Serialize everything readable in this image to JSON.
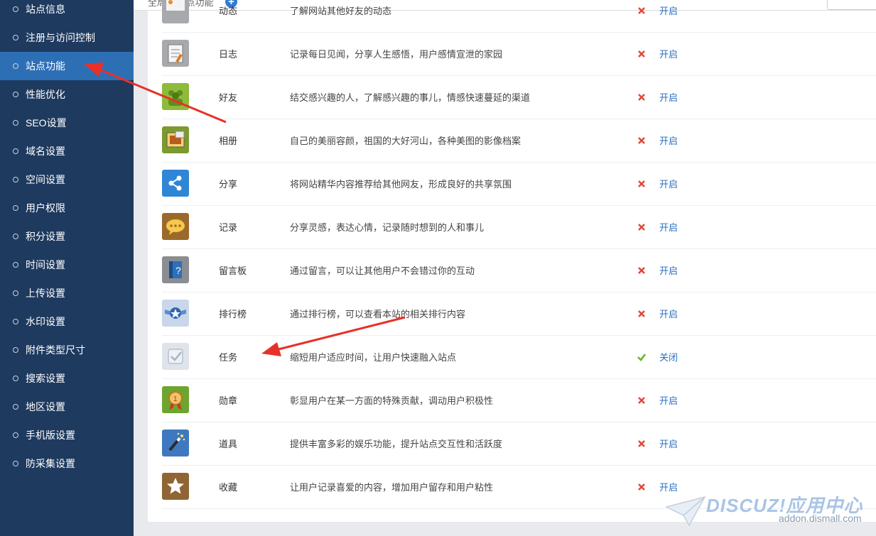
{
  "sidebar": {
    "items": [
      {
        "label": "站点信息"
      },
      {
        "label": "注册与访问控制"
      },
      {
        "label": "站点功能",
        "active": true
      },
      {
        "label": "性能优化"
      },
      {
        "label": "SEO设置"
      },
      {
        "label": "域名设置"
      },
      {
        "label": "空间设置"
      },
      {
        "label": "用户权限"
      },
      {
        "label": "积分设置"
      },
      {
        "label": "时间设置"
      },
      {
        "label": "上传设置"
      },
      {
        "label": "水印设置"
      },
      {
        "label": "附件类型尺寸"
      },
      {
        "label": "搜索设置"
      },
      {
        "label": "地区设置"
      },
      {
        "label": "手机版设置"
      },
      {
        "label": "防采集设置"
      }
    ]
  },
  "header": {
    "breadcrumb": "全局 » 站点功能"
  },
  "features": [
    {
      "name": "动态",
      "desc": "了解网站其他好友的动态",
      "enabled": false,
      "action": "开启",
      "icon": "feed-icon"
    },
    {
      "name": "日志",
      "desc": "记录每日见闻，分享人生感悟，用户感情宣泄的家园",
      "enabled": false,
      "action": "开启",
      "icon": "blog-icon"
    },
    {
      "name": "好友",
      "desc": "结交感兴趣的人，了解感兴趣的事儿，情感快速蔓延的渠道",
      "enabled": false,
      "action": "开启",
      "icon": "friends-icon"
    },
    {
      "name": "相册",
      "desc": "自己的美丽容颜，祖国的大好河山，各种美图的影像档案",
      "enabled": false,
      "action": "开启",
      "icon": "album-icon"
    },
    {
      "name": "分享",
      "desc": "将网站精华内容推荐给其他网友，形成良好的共享氛围",
      "enabled": false,
      "action": "开启",
      "icon": "share-icon"
    },
    {
      "name": "记录",
      "desc": "分享灵感，表达心情，记录随时想到的人和事儿",
      "enabled": false,
      "action": "开启",
      "icon": "doing-icon"
    },
    {
      "name": "留言板",
      "desc": "通过留言，可以让其他用户不会错过你的互动",
      "enabled": false,
      "action": "开启",
      "icon": "wall-icon"
    },
    {
      "name": "排行榜",
      "desc": "通过排行榜，可以查看本站的相关排行内容",
      "enabled": false,
      "action": "开启",
      "icon": "ranklist-icon"
    },
    {
      "name": "任务",
      "desc": "缩短用户适应时间，让用户快速融入站点",
      "enabled": true,
      "action": "关闭",
      "icon": "task-icon"
    },
    {
      "name": "勋章",
      "desc": "彰显用户在某一方面的特殊贡献，调动用户积极性",
      "enabled": false,
      "action": "开启",
      "icon": "medal-icon"
    },
    {
      "name": "道具",
      "desc": "提供丰富多彩的娱乐功能，提升站点交互性和活跃度",
      "enabled": false,
      "action": "开启",
      "icon": "magic-icon"
    },
    {
      "name": "收藏",
      "desc": "让用户记录喜爱的内容，增加用户留存和用户粘性",
      "enabled": false,
      "action": "开启",
      "icon": "favorite-icon"
    }
  ],
  "watermark": {
    "title": "DISCUZ!应用中心",
    "url": "addon.dismall.com"
  },
  "colors": {
    "sidebar_bg": "#1e3a5f",
    "sidebar_active": "#2d6fb5",
    "link": "#2a6ec1",
    "off_mark": "#e04a3a",
    "on_mark": "#6bb32a",
    "annotation_arrow": "#e8302a"
  }
}
